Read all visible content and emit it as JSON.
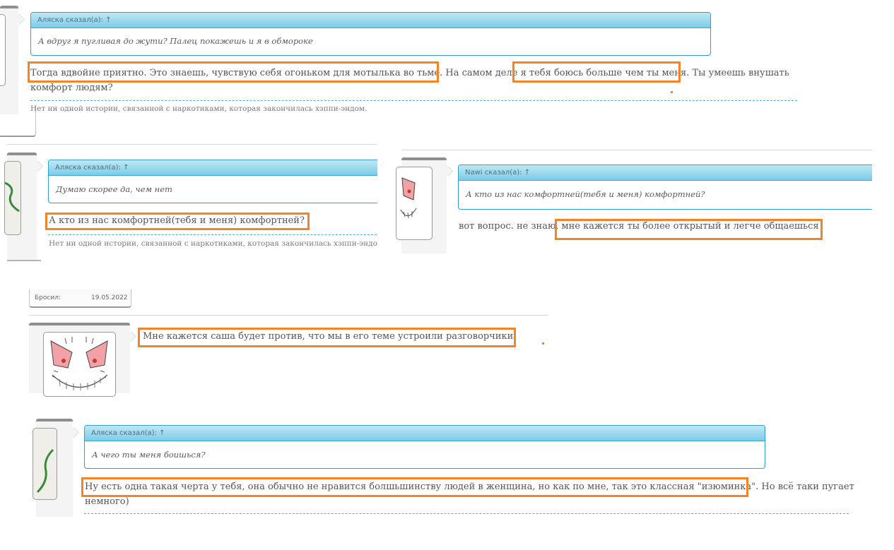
{
  "posts": [
    {
      "quote_header": "Аляска сказал(а): ↑",
      "quote_text": "А вдруг я пугливая до жути? Палец покажешь и я в обмороке",
      "message_line1": "Тогда вдвойне приятно. Это знаешь, чувствую себя огоньком для мотылька во тьме. На самом деле я тебя боюсь больше чем ты меня. Ты умеешь внушать",
      "message_line2": "комфорт людям?",
      "signature": "Нет ни одной истории, связанной с наркотиками, которая закончилась хэппи-эндом."
    },
    {
      "quote_header": "Аляска сказал(а): ↑",
      "quote_text": "Думаю скорее да, чем нет",
      "message": "А кто из нас комфортней(тебя и меня) комфортней?",
      "signature": "Нет ни одной истории, связанной с наркотиками, которая закончилась хэппи-эндом."
    },
    {
      "quote_header": "Nawi сказал(а): ↑",
      "quote_text": "А кто из нас комфортней(тебя и меня) комфортней?",
      "message": "вот вопрос. не знаю, мне кажется ты более открытый и легче общаешься"
    },
    {
      "user_info_label": "Бросил:",
      "user_info_value": "19.05.2022",
      "message": "Мне кажется саша будет против, что мы в его теме устроили разговорчики"
    },
    {
      "quote_header": "Аляска сказал(а): ↑",
      "quote_text": "А чего ты меня боишься?",
      "message_line1": "Ну есть одна такая черта у тебя, она обычно не нравится болшьшинству людей в женщина, но как по мне, так это классная \"изюминка\". Но всё таки пугает",
      "message_line2": "немного)"
    }
  ],
  "colors": {
    "highlight": "#f08426",
    "quote_border": "#2fa0cc",
    "dash": "#56a9cf"
  }
}
